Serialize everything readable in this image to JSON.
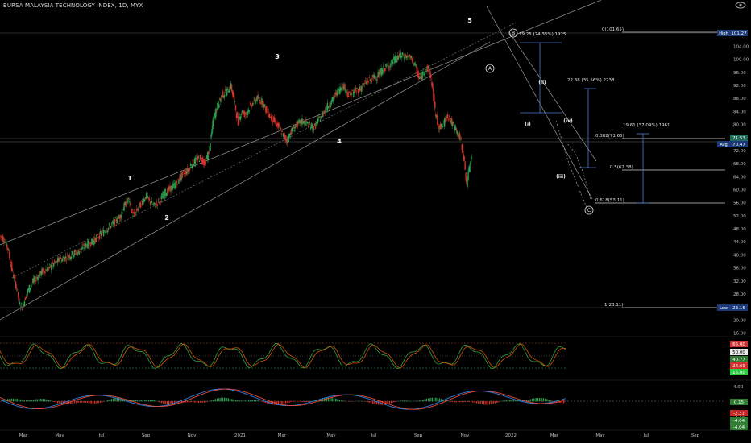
{
  "header": {
    "title": "BURSA MALAYSIA TECHNOLOGY INDEX, 1D, MYX"
  },
  "chart_data": {
    "type": "candlestick",
    "price_axis": {
      "ticks": [
        "104.00",
        "100.00",
        "96.00",
        "92.00",
        "88.00",
        "84.00",
        "80.00",
        "76.00",
        "72.00",
        "68.00",
        "64.00",
        "60.00",
        "56.00",
        "52.00",
        "48.00",
        "44.00",
        "40.00",
        "36.00",
        "32.00",
        "28.00",
        "24.00",
        "20.00",
        "16.00"
      ],
      "ylim": [
        16,
        104
      ],
      "scale": "linear"
    },
    "time_axis": {
      "ticks": [
        "Mar",
        "May",
        "Jul",
        "Sep",
        "Nov",
        "2021",
        "Mar",
        "May",
        "Jul",
        "Sep",
        "Nov",
        "2022",
        "Mar",
        "May",
        "Jul",
        "Sep"
      ]
    },
    "price_path": [
      [
        0,
        46
      ],
      [
        3,
        45
      ],
      [
        6,
        42
      ],
      [
        9,
        35
      ],
      [
        12,
        30
      ],
      [
        14,
        25
      ],
      [
        16,
        24
      ],
      [
        19,
        28
      ],
      [
        22,
        31
      ],
      [
        26,
        33
      ],
      [
        30,
        35
      ],
      [
        35,
        36
      ],
      [
        40,
        38
      ],
      [
        45,
        39
      ],
      [
        50,
        40
      ],
      [
        55,
        41
      ],
      [
        60,
        43
      ],
      [
        65,
        44
      ],
      [
        70,
        46
      ],
      [
        75,
        48
      ],
      [
        80,
        50
      ],
      [
        84,
        52
      ],
      [
        87,
        55
      ],
      [
        90,
        57
      ],
      [
        92,
        53
      ],
      [
        94,
        52
      ],
      [
        96,
        54
      ],
      [
        99,
        56
      ],
      [
        102,
        58
      ],
      [
        105,
        56
      ],
      [
        108,
        55
      ],
      [
        112,
        57
      ],
      [
        115,
        59
      ],
      [
        118,
        60
      ],
      [
        121,
        61
      ],
      [
        125,
        63
      ],
      [
        128,
        65
      ],
      [
        131,
        66
      ],
      [
        134,
        68
      ],
      [
        137,
        69
      ],
      [
        140,
        70
      ],
      [
        143,
        68
      ],
      [
        146,
        72
      ],
      [
        149,
        82
      ],
      [
        152,
        86
      ],
      [
        155,
        89
      ],
      [
        158,
        90
      ],
      [
        161,
        92
      ],
      [
        164,
        86
      ],
      [
        166,
        80
      ],
      [
        168,
        84
      ],
      [
        171,
        83
      ],
      [
        175,
        86
      ],
      [
        179,
        88
      ],
      [
        183,
        87
      ],
      [
        186,
        84
      ],
      [
        189,
        82
      ],
      [
        193,
        80
      ],
      [
        197,
        77
      ],
      [
        200,
        75
      ],
      [
        203,
        78
      ],
      [
        207,
        80
      ],
      [
        211,
        81
      ],
      [
        215,
        80
      ],
      [
        219,
        79
      ],
      [
        223,
        82
      ],
      [
        227,
        85
      ],
      [
        231,
        87
      ],
      [
        235,
        90
      ],
      [
        239,
        92
      ],
      [
        243,
        89
      ],
      [
        247,
        90
      ],
      [
        251,
        91
      ],
      [
        255,
        93
      ],
      [
        259,
        94
      ],
      [
        263,
        95
      ],
      [
        267,
        97
      ],
      [
        271,
        98
      ],
      [
        275,
        100
      ],
      [
        279,
        101
      ],
      [
        283,
        101
      ],
      [
        287,
        100
      ],
      [
        290,
        97
      ],
      [
        292,
        94
      ],
      [
        294,
        95
      ],
      [
        296,
        97
      ],
      [
        299,
        97
      ],
      [
        301,
        92
      ],
      [
        303,
        84
      ],
      [
        305,
        80
      ],
      [
        307,
        79
      ],
      [
        309,
        80
      ],
      [
        311,
        83
      ],
      [
        313,
        82
      ],
      [
        315,
        80
      ],
      [
        317,
        79
      ],
      [
        319,
        77
      ],
      [
        321,
        75
      ],
      [
        323,
        70
      ],
      [
        324,
        65
      ],
      [
        325,
        62
      ],
      [
        326,
        64
      ],
      [
        327,
        67
      ],
      [
        328,
        70
      ]
    ],
    "wave_labels": [
      {
        "text": "1",
        "price": 58.5,
        "t": 84
      },
      {
        "text": "2",
        "price": 48.6,
        "t": 103
      },
      {
        "text": "3",
        "price": 93.7,
        "t": 160
      },
      {
        "text": "4",
        "price": 70.6,
        "t": 197
      },
      {
        "text": "5",
        "price": 107.0,
        "t": 273
      },
      {
        "text": "A",
        "price": 89.8,
        "t": 286,
        "circle": true
      },
      {
        "text": "B",
        "price": 103.9,
        "t": 300,
        "circle": true
      },
      {
        "text": "C",
        "price": 52.2,
        "t": 343,
        "circle": true
      },
      {
        "text": "(i)",
        "price": 76.8,
        "t": 307
      },
      {
        "text": "(ii)",
        "price": 87.0,
        "t": 315
      },
      {
        "text": "(iii)",
        "price": 61.8,
        "t": 326
      },
      {
        "text": "(iv)",
        "price": 76.7,
        "t": 330
      }
    ],
    "fib_levels": [
      {
        "label": "0(101.65)",
        "price": 101.65
      },
      {
        "label": "0.382(71.65)",
        "price": 71.65
      },
      {
        "label": "0.5(62.38)",
        "price": 62.38
      },
      {
        "label": "0.618(53.11)",
        "price": 53.11
      },
      {
        "label": "1(23.11)",
        "price": 23.11
      }
    ],
    "measure_labels": [
      {
        "text": "19.25 (24.35%) 1925",
        "price": 103.9,
        "t": 316
      },
      {
        "text": "22.38 (35.56%) 2238",
        "price": 88.7,
        "t": 337
      },
      {
        "text": "19.61 (37.04%) 1961",
        "price": 74.2,
        "t": 373
      }
    ],
    "price_tags": [
      {
        "label": "High",
        "value": "101.27",
        "color": "#1c3a7a"
      },
      {
        "label": "",
        "value": "71.53",
        "color": "#1e6b5a"
      },
      {
        "label": "Avg",
        "value": "70.47",
        "color": "#1c3a7a"
      },
      {
        "label": "Low",
        "value": "23.16",
        "color": "#1c3a7a"
      }
    ],
    "rsi_panel": {
      "tags": [
        {
          "value": "65.00",
          "color": "#d32f2f"
        },
        {
          "value": "50.00",
          "color": "#e8e8e8"
        },
        {
          "value": "40.77",
          "color": "#2e7d32"
        },
        {
          "value": "24.69",
          "color": "#d32f2f"
        },
        {
          "value": "15.00",
          "color": "#2ecc40"
        }
      ]
    },
    "macd_panel": {
      "ticks": [
        "4.00",
        "0.00",
        "-4.00"
      ],
      "tags": [
        {
          "value": "0.15",
          "color": "#2e7d32"
        },
        {
          "value": "-2.37",
          "color": "#c62828"
        },
        {
          "value": "-4.04",
          "color": "#2e7d32"
        },
        {
          "value": "-4.04",
          "color": "#2e7d32"
        }
      ]
    }
  }
}
